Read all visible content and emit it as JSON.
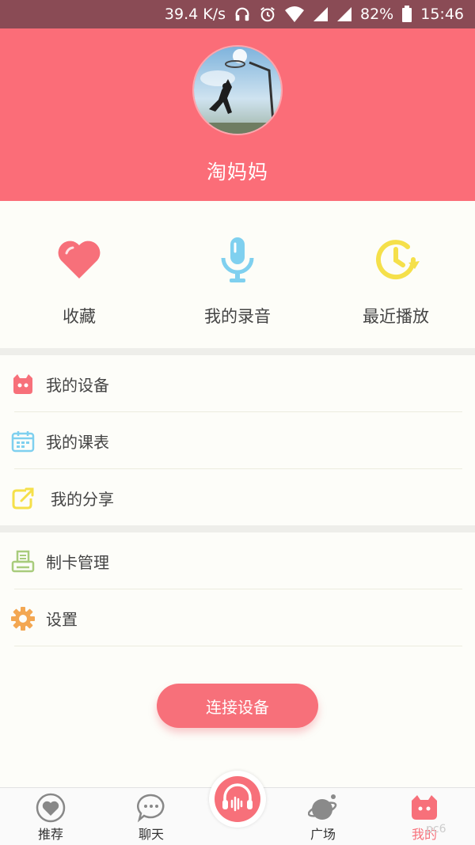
{
  "status_bar": {
    "speed": "39.4 K/s",
    "battery": "82%",
    "time": "15:46",
    "icons": [
      "headphone-icon",
      "alarm-icon",
      "wifi-icon",
      "signal-icon",
      "signal-icon",
      "battery-icon"
    ]
  },
  "profile": {
    "username": "淘妈妈",
    "header_color": "#fb6d78"
  },
  "quick_actions": [
    {
      "label": "收藏",
      "icon": "heart-icon",
      "color": "#f7707a"
    },
    {
      "label": "我的录音",
      "icon": "microphone-icon",
      "color": "#7fd0ef"
    },
    {
      "label": "最近播放",
      "icon": "clock-icon",
      "color": "#f5e04a"
    }
  ],
  "menu": [
    {
      "label": "我的设备",
      "icon": "device-icon"
    },
    {
      "label": "我的课表",
      "icon": "calendar-icon"
    },
    {
      "label": "我的分享",
      "icon": "share-icon"
    },
    {
      "label": "制卡管理",
      "icon": "printer-icon"
    },
    {
      "label": "设置",
      "icon": "gear-icon"
    }
  ],
  "connect_button": {
    "label": "连接设备"
  },
  "tabs": [
    {
      "label": "推荐",
      "icon": "recommend-icon"
    },
    {
      "label": "聊天",
      "icon": "chat-icon"
    },
    {
      "label": "广场",
      "icon": "planet-icon"
    },
    {
      "label": "我的",
      "icon": "mine-icon",
      "active": true
    }
  ],
  "center_button": {
    "icon": "record-icon"
  },
  "watermark": "pc6"
}
